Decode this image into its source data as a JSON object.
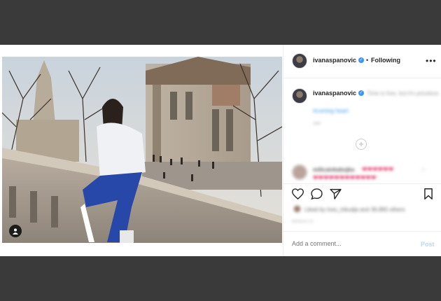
{
  "post": {
    "author": "ivanaspanovic",
    "follow_status": "Following",
    "separator": "•",
    "more_label": "•••"
  },
  "caption": {
    "author": "ivanaspanovic",
    "text": "Time is free, but it's priceless",
    "hashtag": "#coming heart",
    "time": "39w"
  },
  "comments": [
    {
      "user": "milicaivkabojka",
      "text": "❤❤❤❤❤❤",
      "text2": "❤❤❤❤❤❤❤❤❤❤❤❤"
    }
  ],
  "actions": {
    "likes_text": "Liked by ines_trikudja and 36,865 others",
    "date": "MARCH 10"
  },
  "comment_box": {
    "placeholder": "Add a comment...",
    "post_label": "Post"
  },
  "colors": {
    "verified": "#3897f0",
    "post_disabled": "#b3dbff",
    "hearts": "#e0245e"
  }
}
